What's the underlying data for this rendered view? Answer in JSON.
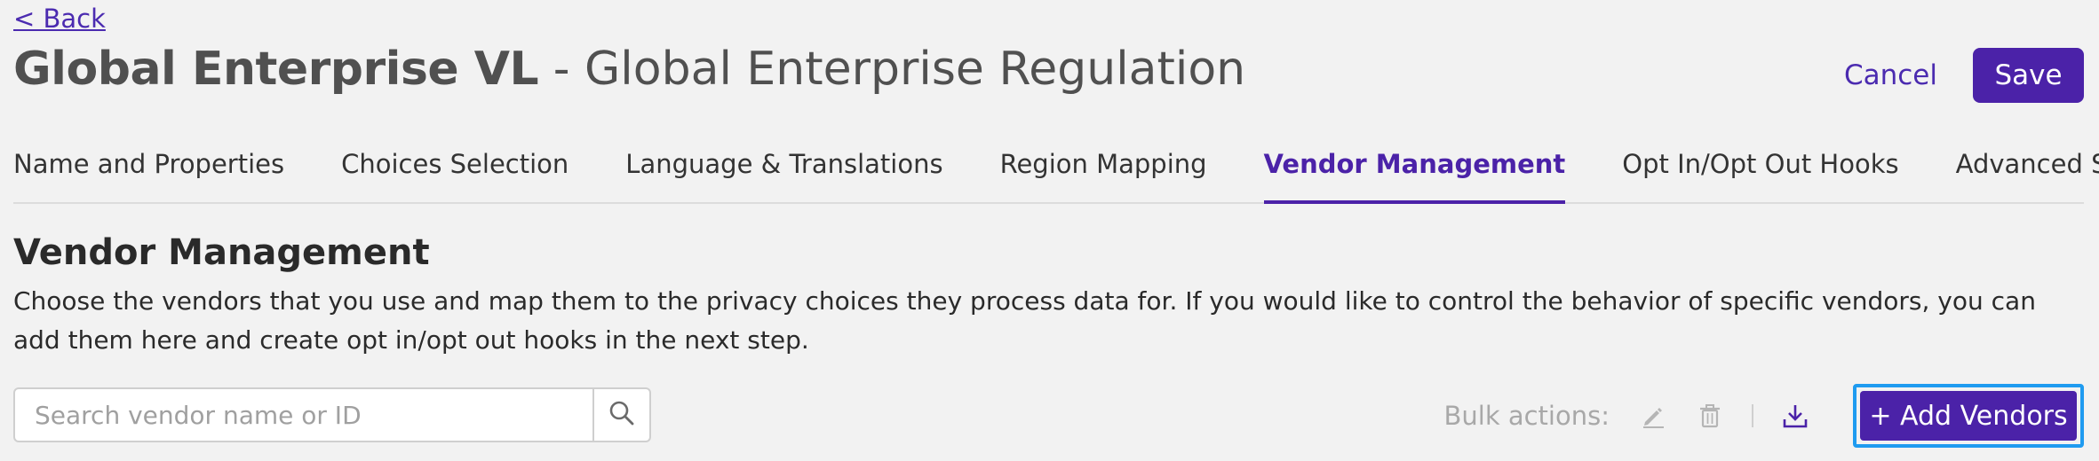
{
  "back": {
    "label": "< Back"
  },
  "header": {
    "title_bold": "Global Enterprise VL",
    "title_sep": " - ",
    "title_sub": "Global Enterprise Regulation",
    "cancel_label": "Cancel",
    "save_label": "Save"
  },
  "tabs": [
    {
      "label": "Name and Properties",
      "active": false
    },
    {
      "label": "Choices Selection",
      "active": false
    },
    {
      "label": "Language & Translations",
      "active": false
    },
    {
      "label": "Region Mapping",
      "active": false
    },
    {
      "label": "Vendor Management",
      "active": true
    },
    {
      "label": "Opt In/Opt Out Hooks",
      "active": false
    },
    {
      "label": "Advanced Settings",
      "active": false
    }
  ],
  "section": {
    "title": "Vendor Management",
    "description": "Choose the vendors that you use and map them to the privacy choices they process data for. If you would like to control the behavior of specific vendors, you can add them here and create opt in/opt out hooks in the next step."
  },
  "search": {
    "placeholder": "Search vendor name or ID",
    "value": ""
  },
  "bulk": {
    "label": "Bulk actions:",
    "icons": [
      "pencil-icon",
      "trash-icon",
      "download-icon"
    ]
  },
  "add_vendors_label": "+ Add Vendors",
  "colors": {
    "accent": "#4b22a8",
    "focus_ring": "#1f9bf0",
    "background": "#f2f2f2"
  }
}
